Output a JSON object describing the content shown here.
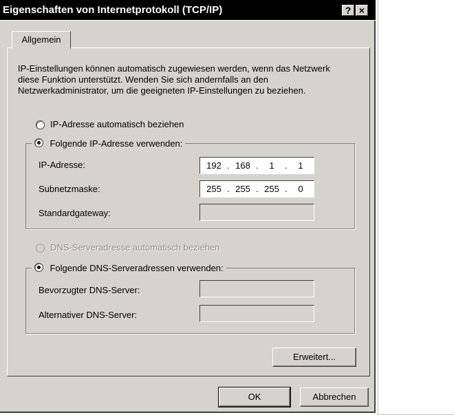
{
  "window": {
    "title": "Eigenschaften von Internetprotokoll (TCP/IP)",
    "help_label": "?",
    "close_label": "×"
  },
  "tabs": [
    {
      "label": "Allgemein",
      "selected": true
    }
  ],
  "intro_text": "IP-Einstellungen können automatisch zugewiesen werden, wenn das Netzwerk diese Funktion unterstützt. Wenden Sie sich andernfalls an den Netzwerkadministrator, um die geeigneten IP-Einstellungen zu beziehen.",
  "ip_options": {
    "auto_label": "IP-Adresse automatisch beziehen",
    "auto_selected": false,
    "manual_label": "Folgende IP-Adresse verwenden:",
    "manual_selected": true
  },
  "ip_fields": {
    "address": {
      "label": "IP-Adresse:",
      "octets": [
        "192",
        "168",
        "1",
        "1"
      ]
    },
    "subnet": {
      "label": "Subnetzmaske:",
      "octets": [
        "255",
        "255",
        "255",
        "0"
      ]
    },
    "gateway": {
      "label": "Standardgateway:",
      "octets": [
        "",
        "",
        "",
        ""
      ]
    }
  },
  "dns_options": {
    "auto_label": "DNS-Serveradresse automatisch beziehen",
    "auto_selected": false,
    "auto_enabled": false,
    "manual_label": "Folgende DNS-Serveradressen verwenden:",
    "manual_selected": true
  },
  "dns_fields": {
    "preferred": {
      "label": "Bevorzugter DNS-Server:",
      "octets": [
        "",
        "",
        "",
        ""
      ]
    },
    "alternate": {
      "label": "Alternativer DNS-Server:",
      "octets": [
        "",
        "",
        "",
        ""
      ]
    }
  },
  "buttons": {
    "advanced": "Erweitert...",
    "ok": "OK",
    "cancel": "Abbrechen"
  },
  "colors": {
    "face": "#d6d3ce",
    "titlebar": "#000000",
    "field_enabled": "#ffffff"
  }
}
